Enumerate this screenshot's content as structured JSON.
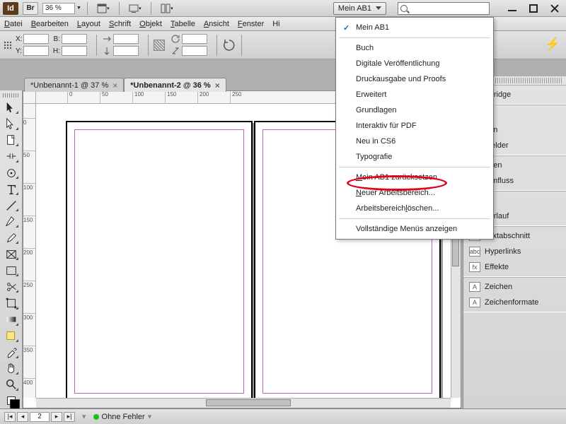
{
  "title_app": "Id",
  "bridge_btn": "Br",
  "zoom_value": "36 %",
  "menubar": [
    "Datei",
    "Bearbeiten",
    "Layout",
    "Schrift",
    "Objekt",
    "Tabelle",
    "Ansicht",
    "Fenster",
    "Hilfe"
  ],
  "workspace_selected": "Mein AB1",
  "search_placeholder": "",
  "ctrl": {
    "x": "X:",
    "y": "Y:",
    "b": "B:",
    "h": "H:"
  },
  "doctabs": [
    {
      "label": "*Unbenannt-1 @ 37 %",
      "active": false
    },
    {
      "label": "*Unbenannt-2 @ 36 %",
      "active": true
    }
  ],
  "hruler_ticks": [
    {
      "pos": 44,
      "label": "0"
    },
    {
      "pos": 90,
      "label": "50"
    },
    {
      "pos": 136,
      "label": "100"
    },
    {
      "pos": 182,
      "label": "150"
    },
    {
      "pos": 228,
      "label": "200"
    },
    {
      "pos": 274,
      "label": "250"
    }
  ],
  "vruler_ticks": [
    {
      "pos": 20,
      "label": "0"
    },
    {
      "pos": 66,
      "label": "50"
    },
    {
      "pos": 112,
      "label": "100"
    },
    {
      "pos": 158,
      "label": "150"
    },
    {
      "pos": 204,
      "label": "200"
    },
    {
      "pos": 250,
      "label": "250"
    },
    {
      "pos": 296,
      "label": "300"
    },
    {
      "pos": 342,
      "label": "350"
    },
    {
      "pos": 388,
      "label": "400"
    }
  ],
  "dropdown": {
    "sections": [
      {
        "items": [
          {
            "label": "Mein AB1",
            "checked": true
          }
        ]
      },
      {
        "items": [
          {
            "label": "Buch"
          },
          {
            "label": "Digitale Veröffentlichung"
          },
          {
            "label": "Druckausgabe und Proofs"
          },
          {
            "label": "Erweitert"
          },
          {
            "label": "Grundlagen"
          },
          {
            "label": "Interaktiv für PDF"
          },
          {
            "label": "Neu in CS6"
          },
          {
            "label": "Typografie"
          }
        ]
      },
      {
        "items": [
          {
            "label": "Mein AB1 zurücksetzen",
            "ul": [
              0
            ]
          },
          {
            "label": "Neuer Arbeitsbereich...",
            "ul": [
              0
            ]
          },
          {
            "label": "Arbeitsbereich löschen...",
            "ul": [
              15
            ]
          }
        ]
      },
      {
        "items": [
          {
            "label": "Vollständige Menüs anzeigen"
          }
        ]
      }
    ]
  },
  "panels": [
    {
      "items": [
        "i Bridge"
      ]
    },
    {
      "items": [
        "en",
        "nen",
        "efelder"
      ]
    },
    {
      "items": [
        "ohen",
        "tumfluss"
      ]
    },
    {
      "items": [
        "tur",
        "Verlauf"
      ]
    },
    {
      "items": [
        "Textabschnitt",
        "Hyperlinks",
        "Effekte"
      ]
    },
    {
      "items": [
        "Zeichen",
        "Zeichenformate"
      ]
    }
  ],
  "panel_icons": {
    "Verlauf": "▭",
    "Textabschnitt": "≣",
    "Hyperlinks": "abc",
    "Effekte": "fx",
    "Zeichen": "A",
    "Zeichenformate": "A"
  },
  "status": {
    "page": "2",
    "errors": "Ohne Fehler"
  },
  "tools": [
    "arrow",
    "direct",
    "page",
    "gap",
    "content",
    "type",
    "line",
    "pen",
    "pencil",
    "rect-frame",
    "rect",
    "scissors",
    "transform",
    "gradient",
    "note",
    "eyedrop",
    "hand",
    "zoom"
  ]
}
